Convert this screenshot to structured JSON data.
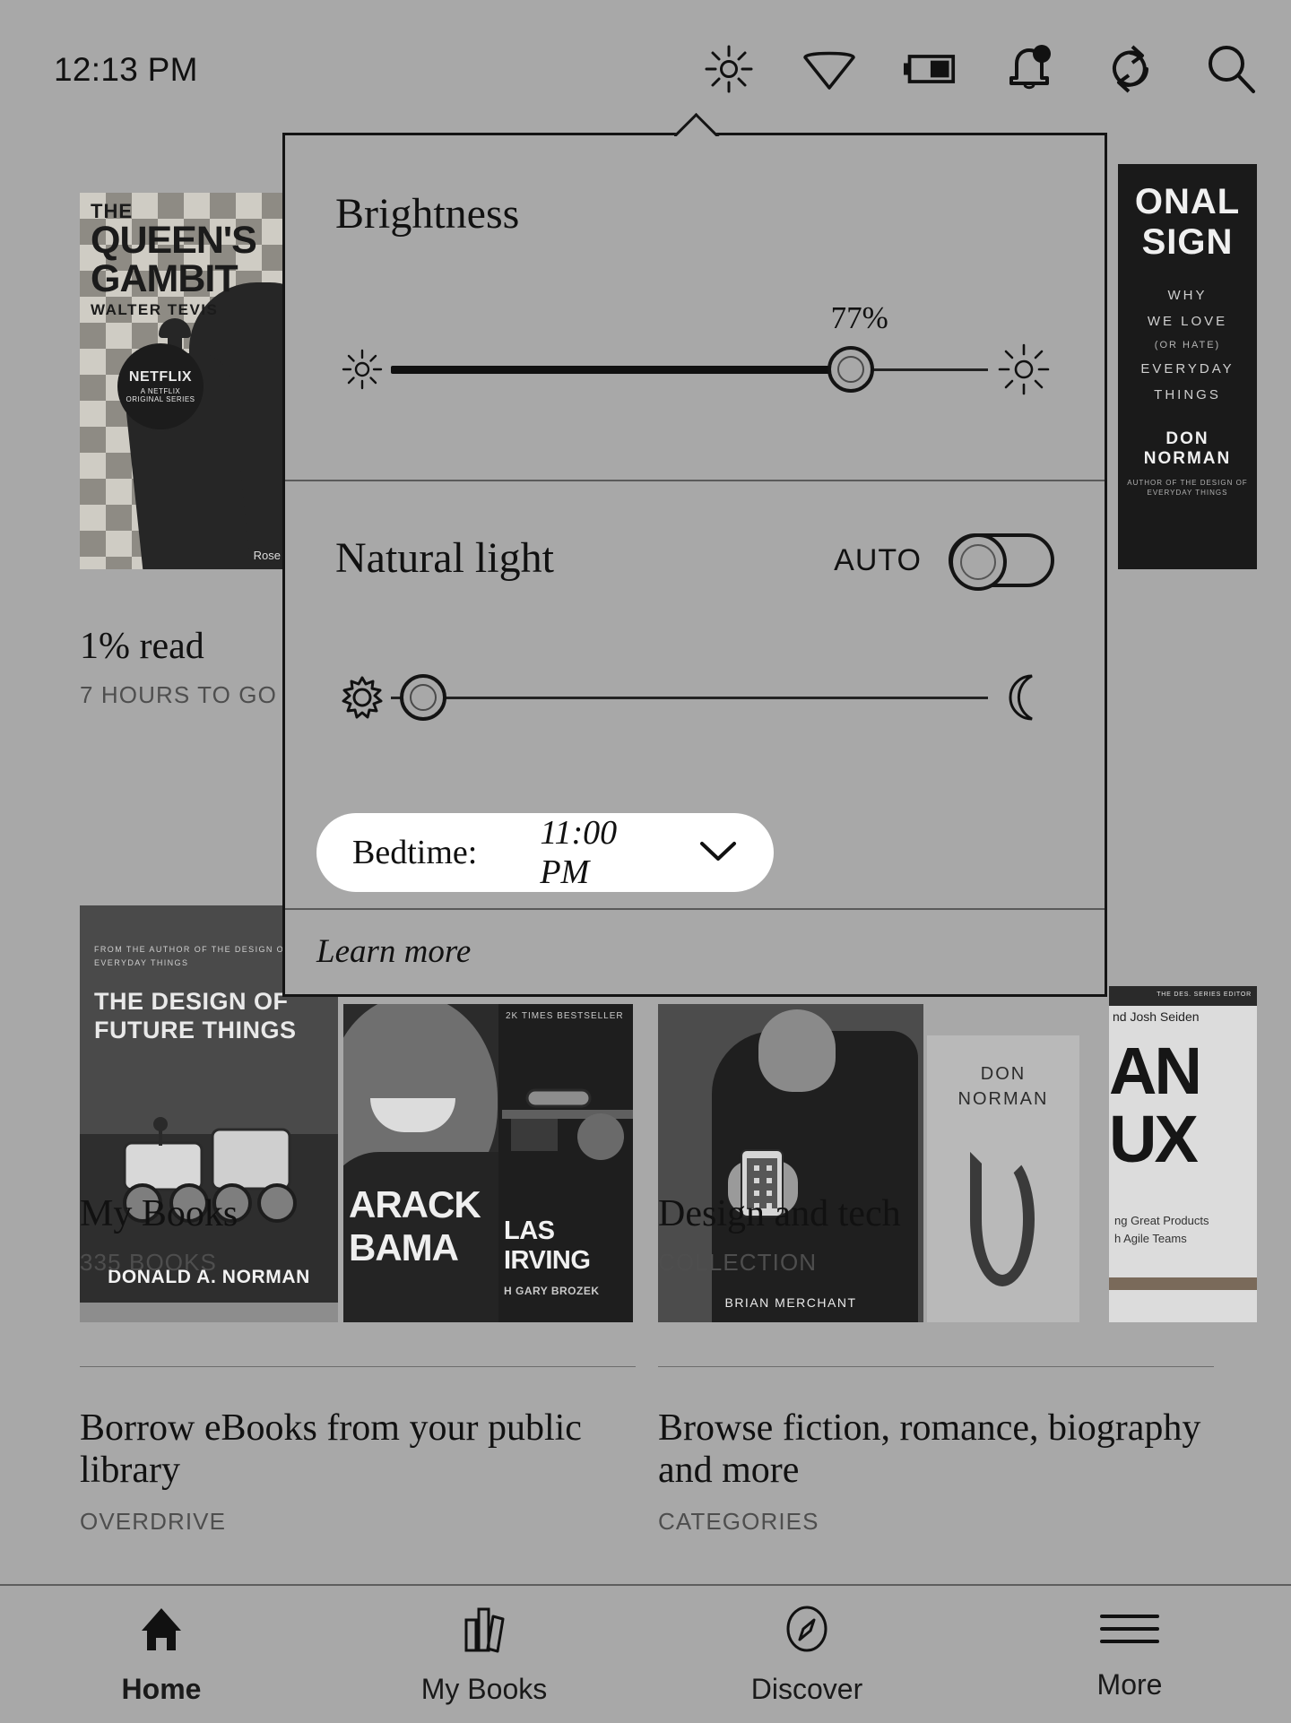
{
  "statusbar": {
    "time": "12:13 PM",
    "icons": [
      {
        "name": "brightness-icon",
        "label": "Brightness"
      },
      {
        "name": "wifi-icon",
        "label": "Wi-Fi"
      },
      {
        "name": "battery-icon",
        "label": "Battery"
      },
      {
        "name": "notifications-icon",
        "label": "Notifications"
      },
      {
        "name": "sync-icon",
        "label": "Sync"
      },
      {
        "name": "search-icon",
        "label": "Search"
      }
    ]
  },
  "panel": {
    "brightness": {
      "title": "Brightness",
      "percent_label": "77%",
      "value": 77,
      "low_icon": "sun-small-icon",
      "high_icon": "sun-large-icon"
    },
    "natural_light": {
      "title": "Natural light",
      "auto_label": "AUTO",
      "auto_on": false,
      "warmth_value": 3,
      "low_icon": "sun-warm-icon",
      "high_icon": "moon-icon"
    },
    "bedtime": {
      "label": "Bedtime:",
      "value": "11:00 PM",
      "chevron": "chevron-down-icon"
    },
    "learn_more": "Learn more"
  },
  "library": {
    "current_book": {
      "progress": "1% read",
      "time_left": "7 HOURS TO GO",
      "cover": {
        "line1": "THE",
        "line2": "QUEEN'S",
        "line3": "GAMBIT",
        "author": "WALTER TEVIS",
        "badge_line1": "NETFLIX",
        "badge_line2": "A NETFLIX",
        "badge_line3": "ORIGINAL SERIES",
        "credit": "Rose"
      }
    },
    "emotional_design_cover": {
      "line1": "ONAL",
      "line2": "SIGN",
      "line3": "WHY",
      "line4": "WE LOVE",
      "line5": "(OR HATE)",
      "line6": "EVERYDAY",
      "line7": "THINGS",
      "author1": "DON",
      "author2": "NORMAN",
      "footer": "AUTHOR OF THE DESIGN OF EVERYDAY THINGS"
    },
    "shelves": [
      {
        "title": "My Books",
        "subtitle": "335 BOOKS",
        "covers": [
          {
            "name": "design-of-future-things",
            "kicker": "FROM THE AUTHOR OF THE DESIGN OF EVERYDAY THINGS",
            "title": "THE DESIGN OF FUTURE THINGS",
            "author": "DONALD A. NORMAN"
          },
          {
            "name": "a-promised-land",
            "title_line1": "ARACK",
            "title_line2": "BAMA"
          },
          {
            "name": "american-sniper",
            "kicker": "2K TIMES BESTSELLER",
            "title": "LAS IRVING",
            "subtitle": "H GARY BROZEK"
          }
        ]
      },
      {
        "title": "Design and tech",
        "subtitle": "COLLECTION",
        "covers": [
          {
            "name": "the-one-device",
            "author": "BRIAN MERCHANT"
          },
          {
            "name": "the-design-of-everyday-things",
            "author_line1": "DON",
            "author_line2": "NORMAN"
          },
          {
            "name": "lean-ux",
            "top_strip": "THE DES. SERIES EDITOR",
            "authors": "nd Josh Seiden",
            "title_line1": "AN",
            "title_line2": "UX",
            "subtitle_line1": "ng Great Products",
            "subtitle_line2": "h Agile Teams"
          }
        ]
      }
    ],
    "links": [
      {
        "title": "Borrow eBooks from your public library",
        "subtitle": "OVERDRIVE"
      },
      {
        "title": "Browse fiction, romance, biography and more",
        "subtitle": "CATEGORIES"
      }
    ]
  },
  "navbar": {
    "items": [
      {
        "label": "Home",
        "icon": "home-icon",
        "active": true
      },
      {
        "label": "My Books",
        "icon": "books-icon",
        "active": false
      },
      {
        "label": "Discover",
        "icon": "compass-icon",
        "active": false
      },
      {
        "label": "More",
        "icon": "hamburger-icon",
        "active": false
      }
    ]
  }
}
